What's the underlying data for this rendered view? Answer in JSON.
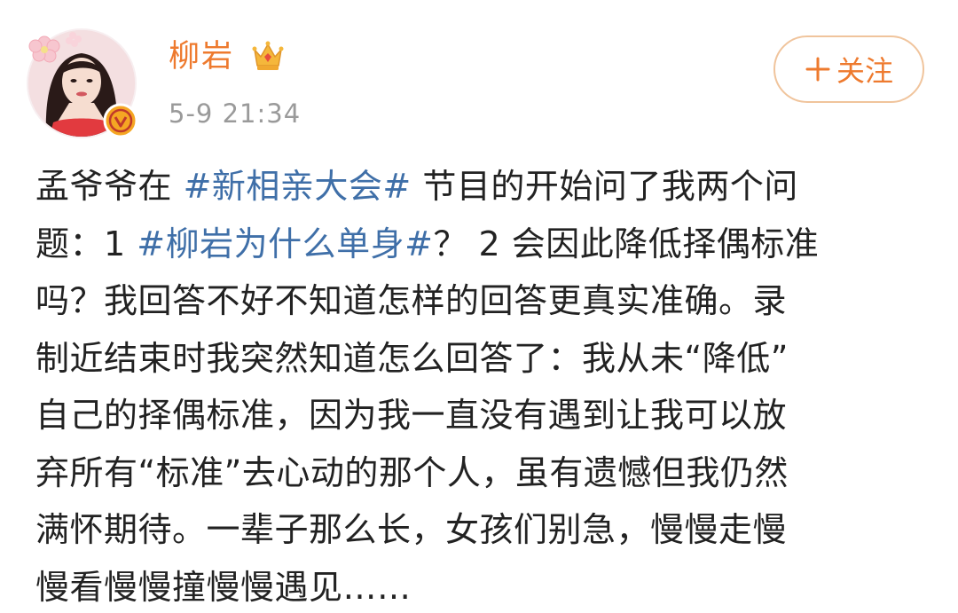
{
  "author": {
    "name": "柳岩",
    "timestamp": "5-9 21:34",
    "badges": [
      "verified-icon",
      "crown-icon"
    ]
  },
  "follow_button": {
    "icon": "plus-icon",
    "label": "关注"
  },
  "colors": {
    "username": "#ee7a2e",
    "hashtag": "#3f6fa8",
    "text": "#222222",
    "timestamp": "#9a9a9a",
    "follow_border": "#f0c49c"
  },
  "post": {
    "lines": [
      [
        {
          "t": "孟爷爷在 ",
          "tag": false
        },
        {
          "t": "#新相亲大会#",
          "tag": true
        },
        {
          "t": " 节目的开始问了我两个问",
          "tag": false
        }
      ],
      [
        {
          "t": "题：1 ",
          "tag": false
        },
        {
          "t": "#柳岩为什么单身#",
          "tag": true
        },
        {
          "t": "？ 2 会因此降低择偶标准",
          "tag": false
        }
      ],
      [
        {
          "t": "吗？我回答不好不知道怎样的回答更真实准确。录",
          "tag": false
        }
      ],
      [
        {
          "t": "制近结束时我突然知道怎么回答了：我从未“降低”",
          "tag": false
        }
      ],
      [
        {
          "t": "自己的择偶标准，因为我一直没有遇到让我可以放",
          "tag": false
        }
      ],
      [
        {
          "t": "弃所有“标准”去心动的那个人，虽有遗憾但我仍然",
          "tag": false
        }
      ],
      [
        {
          "t": "满怀期待。一辈子那么长，女孩们别急，慢慢走慢",
          "tag": false
        }
      ],
      [
        {
          "t": "慢看慢慢撞慢慢遇见……",
          "tag": false
        }
      ]
    ]
  }
}
